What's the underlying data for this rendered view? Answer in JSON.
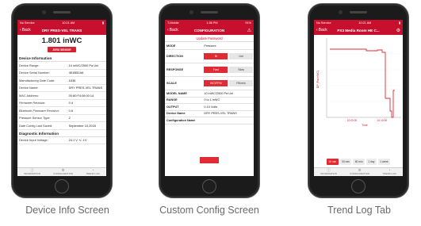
{
  "colors": {
    "brand_red": "#c8102e",
    "active_red": "#e02a34"
  },
  "captions": [
    "Device Info Screen",
    "Custom Config Screen",
    "Trend Log Tab"
  ],
  "device_info": {
    "status_left": "No Service",
    "status_time": "10:21 AM",
    "back_label": "Back",
    "title": "DRY PRES-VEL TRANS",
    "reading": "1.801 inWC",
    "zero_button": "ZERO SENSOR",
    "section_device": "Device Information",
    "rows": [
      {
        "label": "Device Range:",
        "value": "10 inWC/2500 Pa Uni",
        "italic": false
      },
      {
        "label": "Device Serial Number:",
        "value": "4E4B52A6",
        "italic": false
      },
      {
        "label": "Manufacturing Date Code:",
        "value": "1836",
        "italic": false
      },
      {
        "label": "Device Name:",
        "value": "DRY PRES-VEL TRANS",
        "italic": false
      },
      {
        "label": "MAC Address:",
        "value": "00:80:F4:08:00:14",
        "italic": false
      },
      {
        "label": "Firmware Revision:",
        "value": "0.4",
        "italic": true
      },
      {
        "label": "Bluetooth Firmware Revision:",
        "value": "0.6",
        "italic": true
      },
      {
        "label": "Pressure Sensor Type:",
        "value": "2",
        "italic": false
      },
      {
        "label": "Date Config Last Saved:",
        "value": "September 10,2018",
        "italic": false
      }
    ],
    "section_diag": "Diagnostic Information",
    "diag_row": {
      "label": "Device Input Voltage:",
      "value": "24.1 V +/- 1V"
    },
    "tabs": [
      "INFORMATION",
      "CONFIGURATION",
      "TREND LOG"
    ]
  },
  "config": {
    "status_left": "T-Mobile",
    "status_time": "1:58 PM",
    "status_right": "91%",
    "back_label": "Back",
    "title": "CONFIGURATION",
    "subtitle": "Update Password",
    "mode": {
      "label": "MODE",
      "value": "Pressure"
    },
    "direction": {
      "label": "DIRECTION",
      "options": [
        "Bi",
        "Uni"
      ],
      "selected": 0
    },
    "response": {
      "label": "RESPONSE",
      "options": [
        "Fast",
        "Slow"
      ],
      "selected": 0
    },
    "scale": {
      "label": "SCALE",
      "options": [
        "WC/FPM",
        "PA/m/s"
      ],
      "selected": 0
    },
    "rows": [
      {
        "label": "MODEL NAME",
        "value": "10 inWC/2500 Pa Uni"
      },
      {
        "label": "RANGE",
        "value": "0 to 1 inWC"
      },
      {
        "label": "OUTPUT",
        "value": "0-10 Volts"
      },
      {
        "label": "Device Name",
        "value": "DRY PRES-VEL TRANS"
      },
      {
        "label": "Configuration Name",
        "value": ""
      }
    ]
  },
  "trend": {
    "status_left": "No Service",
    "status_time": "10:21 AM",
    "back_label": "Back",
    "title": "PX3 Media Room HE C...",
    "y_label": "DP (Pa/inWC)",
    "x_label": "Time",
    "x_ticks": [
      "10:00:00",
      "10:10:00"
    ],
    "ranges": [
      "10 min",
      "30 min",
      "60 min",
      "1 day",
      "1 week"
    ],
    "selected_range": 0,
    "tabs": [
      "INFORMATION",
      "CONFIGURATION",
      "TREND LOG"
    ]
  }
}
